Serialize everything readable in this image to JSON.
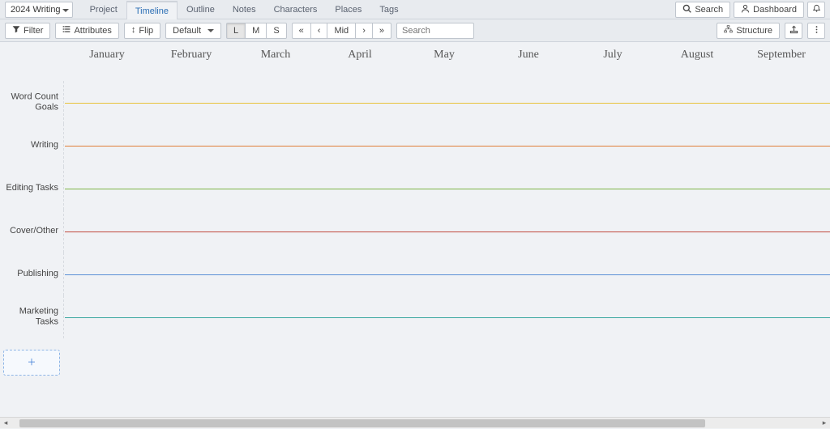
{
  "project_select": "2024 Writing",
  "nav": {
    "tabs": [
      "Project",
      "Timeline",
      "Outline",
      "Notes",
      "Characters",
      "Places",
      "Tags"
    ],
    "active_index": 1
  },
  "top_right": {
    "search_label": "Search",
    "dashboard_label": "Dashboard"
  },
  "toolbar": {
    "filter_label": "Filter",
    "attributes_label": "Attributes",
    "flip_label": "Flip",
    "default_label": "Default",
    "zoom": {
      "options": [
        "L",
        "M",
        "S"
      ],
      "selected_index": 0
    },
    "nav_buttons": {
      "first": "«",
      "prev": "‹",
      "mid": "Mid",
      "next": "›",
      "last": "»"
    },
    "search_placeholder": "Search",
    "structure_label": "Structure"
  },
  "months": [
    "January",
    "February",
    "March",
    "April",
    "May",
    "June",
    "July",
    "August",
    "September"
  ],
  "tracks": [
    {
      "label": "Word Count\nGoals",
      "color": "#e8c23a"
    },
    {
      "label": "Writing",
      "color": "#e0803a"
    },
    {
      "label": "Editing Tasks",
      "color": "#7fb547"
    },
    {
      "label": "Cover/Other",
      "color": "#c14a3d"
    },
    {
      "label": "Publishing",
      "color": "#5a8fd6"
    },
    {
      "label": "Marketing\nTasks",
      "color": "#3aa7a0"
    }
  ]
}
